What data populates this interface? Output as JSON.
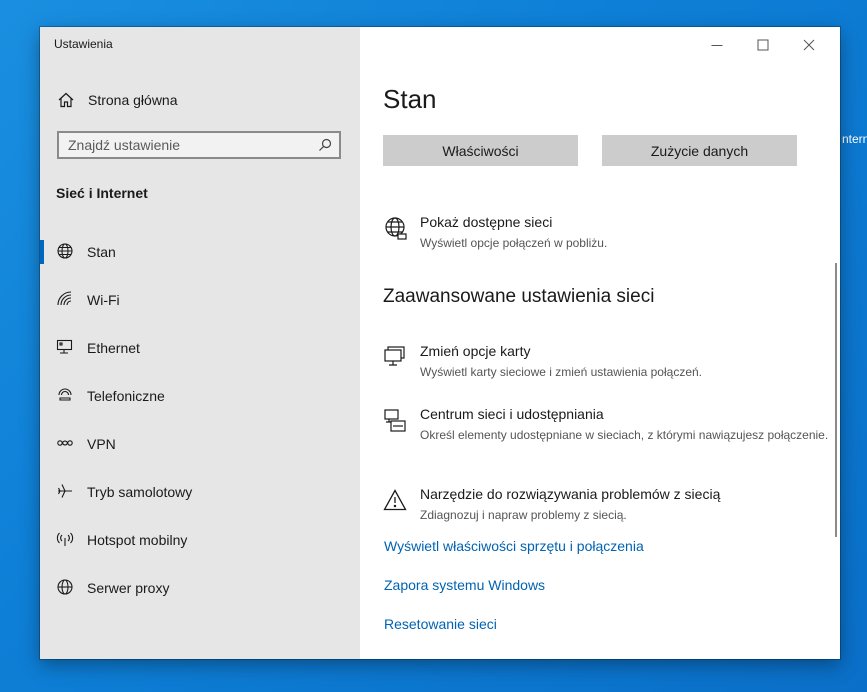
{
  "desktop": {
    "edge_text": "nternet"
  },
  "window": {
    "title": "Ustawienia",
    "controls": {
      "minimize": "minimize-icon",
      "maximize": "maximize-icon",
      "close": "close-icon"
    }
  },
  "sidebar": {
    "home_label": "Strona główna",
    "search_placeholder": "Znajdź ustawienie",
    "section_title": "Sieć i Internet",
    "items": [
      {
        "label": "Stan",
        "icon": "globe-status-icon",
        "active": true
      },
      {
        "label": "Wi-Fi",
        "icon": "wifi-icon",
        "active": false
      },
      {
        "label": "Ethernet",
        "icon": "ethernet-icon",
        "active": false
      },
      {
        "label": "Telefoniczne",
        "icon": "dialup-icon",
        "active": false
      },
      {
        "label": "VPN",
        "icon": "vpn-icon",
        "active": false
      },
      {
        "label": "Tryb samolotowy",
        "icon": "airplane-icon",
        "active": false
      },
      {
        "label": "Hotspot mobilny",
        "icon": "hotspot-icon",
        "active": false
      },
      {
        "label": "Serwer proxy",
        "icon": "globe-icon",
        "active": false
      }
    ]
  },
  "main": {
    "title": "Stan",
    "buttons": {
      "properties": "Właściwości",
      "data_usage": "Zużycie danych"
    },
    "show_networks": {
      "title": "Pokaż dostępne sieci",
      "desc": "Wyświetl opcje połączeń w pobliżu."
    },
    "advanced_heading": "Zaawansowane ustawienia sieci",
    "advanced": [
      {
        "title": "Zmień opcje karty",
        "desc": "Wyświetl karty sieciowe i zmień ustawienia połączeń."
      },
      {
        "title": "Centrum sieci i udostępniania",
        "desc": "Określ elementy udostępniane w sieciach, z którymi nawiązujesz połączenie."
      },
      {
        "title": "Narzędzie do rozwiązywania problemów z siecią",
        "desc": "Zdiagnozuj i napraw problemy z siecią."
      }
    ],
    "links": [
      "Wyświetl właściwości sprzętu i połączenia",
      "Zapora systemu Windows",
      "Resetowanie sieci"
    ]
  },
  "colors": {
    "accent": "#0067c0",
    "link": "#0063b1",
    "sidebar_bg": "#e6e6e6",
    "button_bg": "#cccccc"
  }
}
